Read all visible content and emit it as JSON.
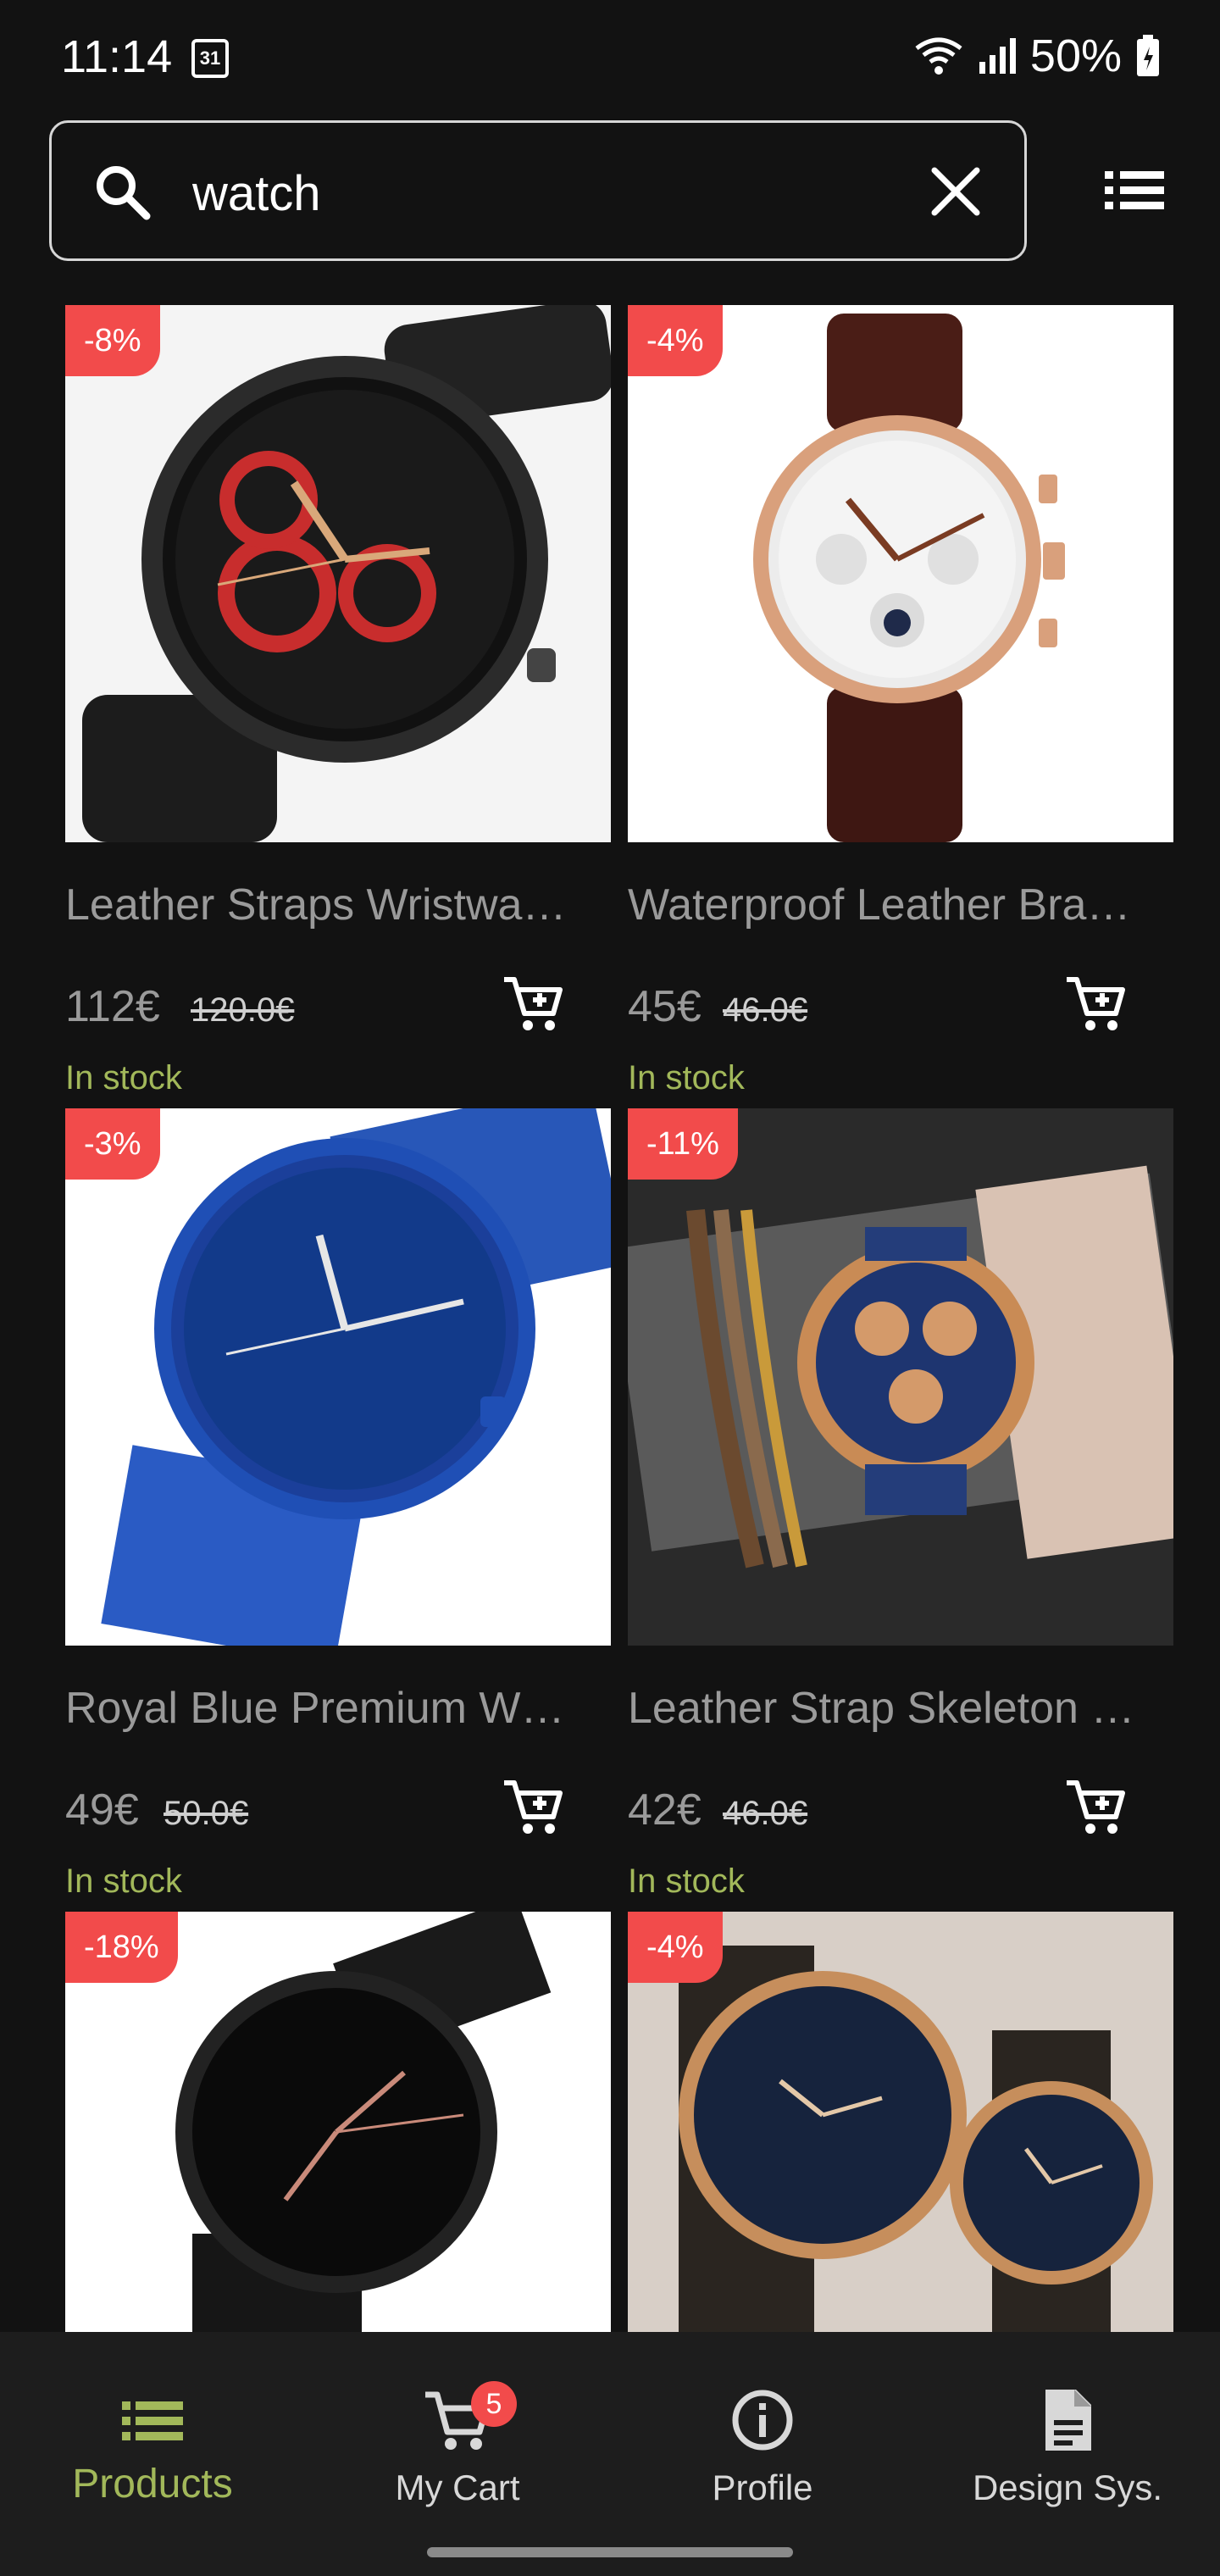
{
  "status_bar": {
    "time": "11:14",
    "calendar_day": "31",
    "battery": "50%"
  },
  "search": {
    "value": "watch",
    "placeholder": ""
  },
  "products": [
    {
      "discount": "-8%",
      "name": "Leather Straps Wristwa…",
      "price": "112€",
      "old_price": "120.0€",
      "stock": "In stock"
    },
    {
      "discount": "-4%",
      "name": "Waterproof Leather Bra…",
      "price": "45€",
      "old_price": "46.0€",
      "stock": "In stock"
    },
    {
      "discount": "-3%",
      "name": "Royal Blue Premium W…",
      "price": "49€",
      "old_price": "50.0€",
      "stock": "In stock"
    },
    {
      "discount": "-11%",
      "name": "Leather Strap Skeleton …",
      "price": "42€",
      "old_price": "46.0€",
      "stock": "In stock"
    },
    {
      "discount": "-18%"
    },
    {
      "discount": "-4%"
    }
  ],
  "nav": {
    "products": "Products",
    "cart": "My Cart",
    "cart_count": "5",
    "profile": "Profile",
    "design": "Design Sys."
  },
  "colors": {
    "background": "#121212",
    "accent": "#a2b85a",
    "badge": "#f24b4b",
    "nav_bg": "#1d1d1d"
  }
}
